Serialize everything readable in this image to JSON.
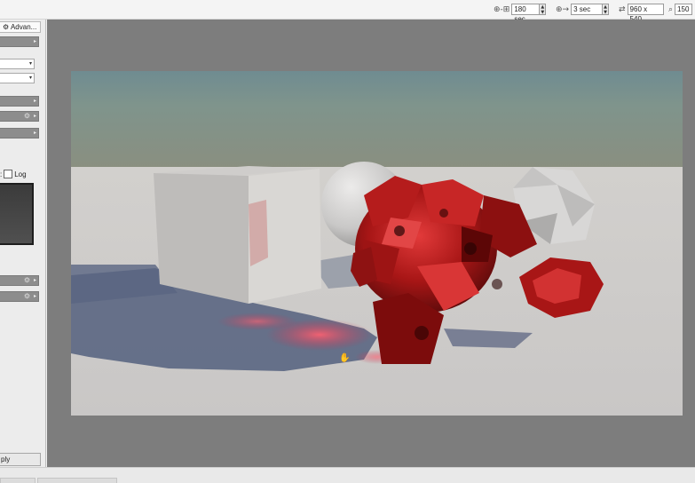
{
  "toolbar": {
    "time_limit": "180 sec",
    "refresh_interval": "3 sec",
    "resolution": "960 x 540",
    "zoom": "150"
  },
  "left_panel": {
    "advanced_tab": "⚙ Advan...",
    "log_colon": ":",
    "log_label": "Log",
    "log_checked": false,
    "apply_label": "ply"
  },
  "colors": {
    "viewport_bg": "#7d7d7d",
    "panel_bar": "#8d8d8d",
    "glass_red": "#a31414"
  }
}
